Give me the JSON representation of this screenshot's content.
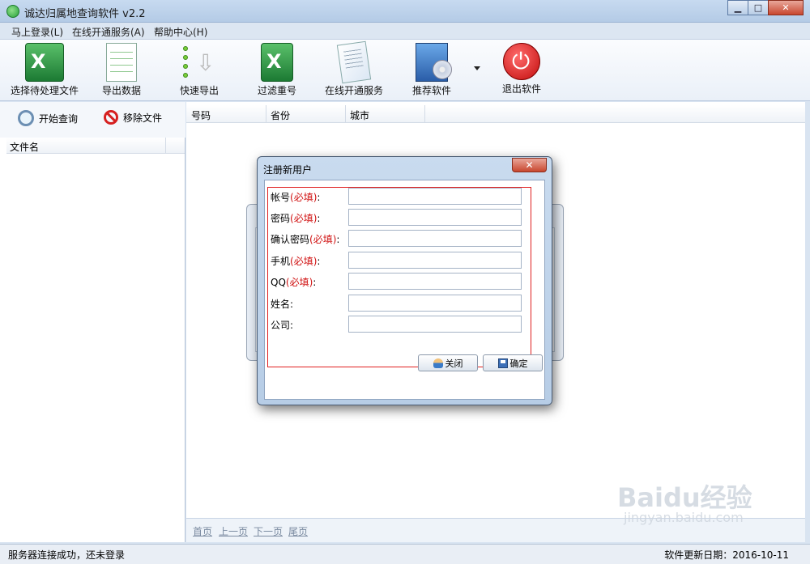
{
  "window": {
    "title": "诚达归属地查询软件 v2.2",
    "btn_min": "▁",
    "btn_max": "□",
    "btn_close": "✕"
  },
  "menu": [
    "马上登录(L)",
    "在线开通服务(A)",
    "帮助中心(H)"
  ],
  "toolbar": [
    {
      "label": "选择待处理文件",
      "icon": "excel-icon"
    },
    {
      "label": "导出数据",
      "icon": "spreadsheet-icon"
    },
    {
      "label": "快速导出",
      "icon": "quick-export-icon"
    },
    {
      "label": "过滤重号",
      "icon": "filter-icon"
    },
    {
      "label": "在线开通服务",
      "icon": "document-icon"
    },
    {
      "label": "推荐软件",
      "icon": "software-box-icon"
    },
    {
      "label": "退出软件",
      "icon": "power-icon"
    }
  ],
  "left_panel": {
    "start_query": "开始查询",
    "remove_file": "移除文件",
    "file_col": "文件名"
  },
  "grid": {
    "columns": [
      "号码",
      "省份",
      "城市"
    ]
  },
  "pager": [
    "首页",
    "上一页",
    "下一页",
    "尾页"
  ],
  "status": {
    "left": "服务器连接成功，还未登录",
    "right": "软件更新日期：2016-10-11"
  },
  "dialog": {
    "title": "注册新用户",
    "close_x": "✕",
    "fields": [
      {
        "label": "帐号",
        "required": "(必填)",
        "colon": ":",
        "value": ""
      },
      {
        "label": "密码",
        "required": "(必填)",
        "colon": ":",
        "value": ""
      },
      {
        "label": "确认密码",
        "required": "(必填)",
        "colon": ":",
        "value": ""
      },
      {
        "label": "手机",
        "required": "(必填)",
        "colon": ":",
        "value": ""
      },
      {
        "label": "QQ",
        "required": "(必填)",
        "colon": ":",
        "value": ""
      },
      {
        "label": "姓名",
        "required": "",
        "colon": ":",
        "value": ""
      },
      {
        "label": "公司",
        "required": "",
        "colon": ":",
        "value": ""
      }
    ],
    "btn_close": "关闭",
    "btn_ok": "确定"
  },
  "watermark": {
    "main": "Baidu经验",
    "sub": "jingyan.baidu.com"
  }
}
